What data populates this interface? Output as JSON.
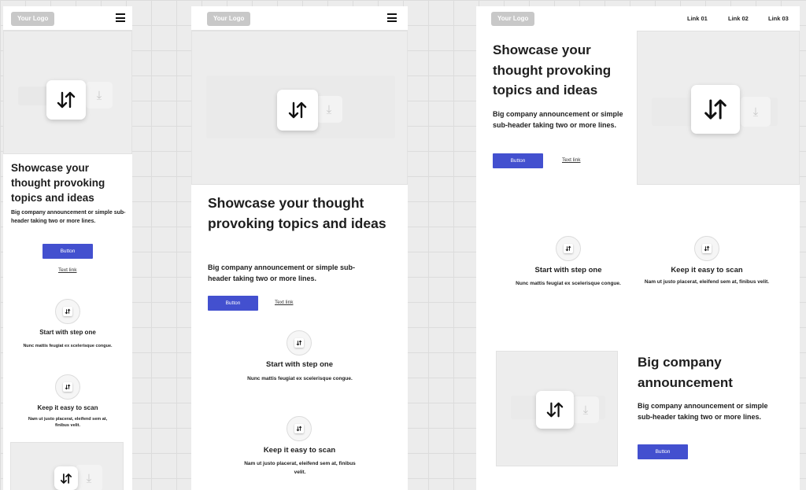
{
  "logo": "Your Logo",
  "nav": {
    "links": [
      "Link 01",
      "Link 02",
      "Link 03"
    ]
  },
  "hero": {
    "heading": "Showcase your thought provoking topics and ideas",
    "subheader": "Big company announcement or simple sub-header taking two or more lines.",
    "button": "Button",
    "text_link": "Text link"
  },
  "steps": [
    {
      "title": "Start with step one",
      "text": "Nunc mattis feugiat ex scelerisque congue."
    },
    {
      "title": "Keep it easy to scan",
      "text": "Nam ut justo placerat, eleifend sem at, finibus velit."
    }
  ],
  "feature": {
    "heading": "Big company announcement",
    "subheader": "Big company announcement or simple sub-header taking two or more lines.",
    "button": "Button"
  },
  "icons": {
    "swap": "swap-arrows-icon",
    "download": "download-icon",
    "menu": "hamburger-menu-icon"
  },
  "colors": {
    "accent": "#4350cf",
    "logo_bg": "#c8c8c8",
    "placeholder_bg": "#ededed"
  }
}
